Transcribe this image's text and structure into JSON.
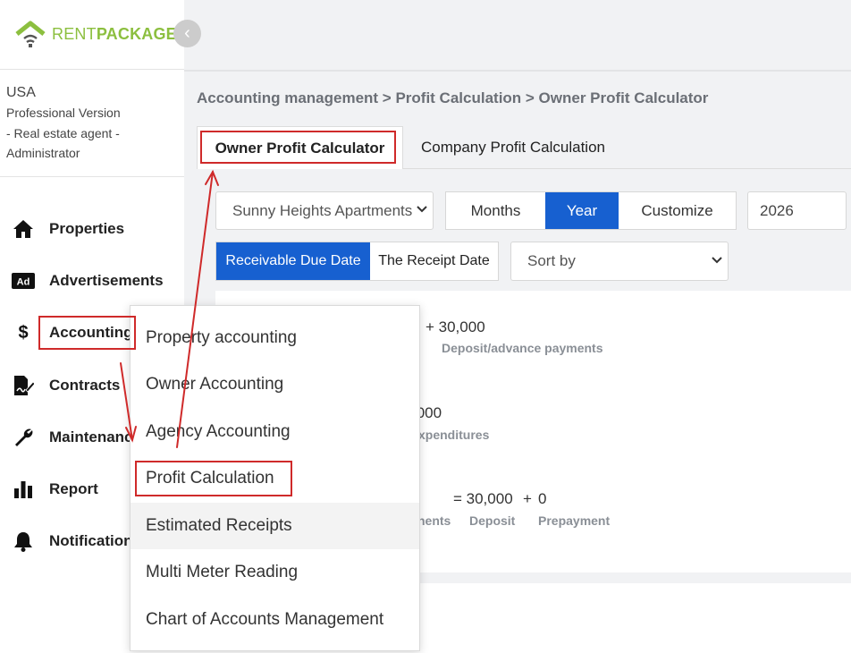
{
  "brand": {
    "name_part1": "RENT",
    "name_part2": "PACKAGE",
    "logo_color": "#8cbf3f"
  },
  "user": {
    "country": "USA",
    "edition": "Professional Version",
    "role_line1": "- Real estate agent -",
    "role_line2": "Administrator"
  },
  "sidebar": {
    "items": [
      {
        "label": "Properties",
        "icon": "home-icon"
      },
      {
        "label": "Advertisements",
        "icon": "ad-icon"
      },
      {
        "label": "Accounting",
        "icon": "dollar-icon"
      },
      {
        "label": "Contracts",
        "icon": "contract-icon"
      },
      {
        "label": "Maintenance",
        "icon": "wrench-icon"
      },
      {
        "label": "Report",
        "icon": "bar-chart-icon"
      },
      {
        "label": "Notifications",
        "icon": "bell-icon"
      }
    ]
  },
  "breadcrumb": "Accounting management > Profit Calculation > Owner Profit Calculator",
  "tabs": [
    {
      "label": "Owner Profit Calculator",
      "active": true
    },
    {
      "label": "Company Profit Calculation",
      "active": false
    }
  ],
  "filters": {
    "property": "Sunny Heights Apartments",
    "period_options": [
      "Months",
      "Year",
      "Customize"
    ],
    "period_selected": "Year",
    "year": "2026",
    "date_basis_options": [
      "Receivable Due Date",
      "The Receipt Date"
    ],
    "date_basis_selected": "Receivable Due Date",
    "sort_placeholder": "Sort by"
  },
  "summary": {
    "row1": {
      "amount": "+ 30,000",
      "caption": "Deposit/advance payments"
    },
    "row2": {
      "amount": ",000",
      "caption": "xpenditures"
    },
    "row3": {
      "eq": "= 30,000",
      "plus": "+",
      "zero": "0",
      "cap_a": "nents",
      "cap_b": "Deposit",
      "cap_c": "Prepayment"
    }
  },
  "accounting_menu": {
    "items": [
      "Property accounting",
      "Owner Accounting",
      "Agency Accounting",
      "Profit Calculation",
      "Estimated Receipts",
      "Multi Meter Reading",
      "Chart of Accounts Management"
    ],
    "hovered": "Estimated Receipts"
  },
  "colors": {
    "primary": "#1760d0",
    "annotation": "#cf2a2a",
    "brand_green": "#8cbf3f"
  }
}
